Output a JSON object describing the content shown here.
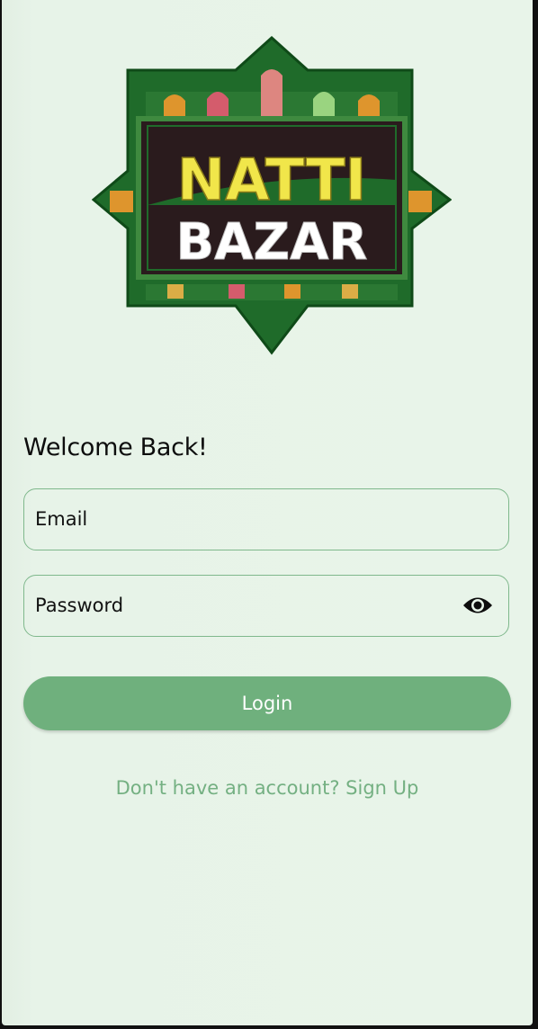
{
  "logo": {
    "line1": "NATTI",
    "line2": "BAZAR"
  },
  "login": {
    "heading": "Welcome Back!",
    "email_placeholder": "Email",
    "password_placeholder": "Password",
    "submit_label": "Login",
    "signup_prompt": "Don't have an account? Sign Up"
  },
  "colors": {
    "background": "#e8f4e9",
    "accent": "#6fb07d",
    "field_border": "#7fb88c",
    "link": "#74b082",
    "logo_green": "#1f6b2a",
    "logo_yellow": "#f1e64a"
  },
  "icons": {
    "password_toggle": "eye-icon"
  }
}
